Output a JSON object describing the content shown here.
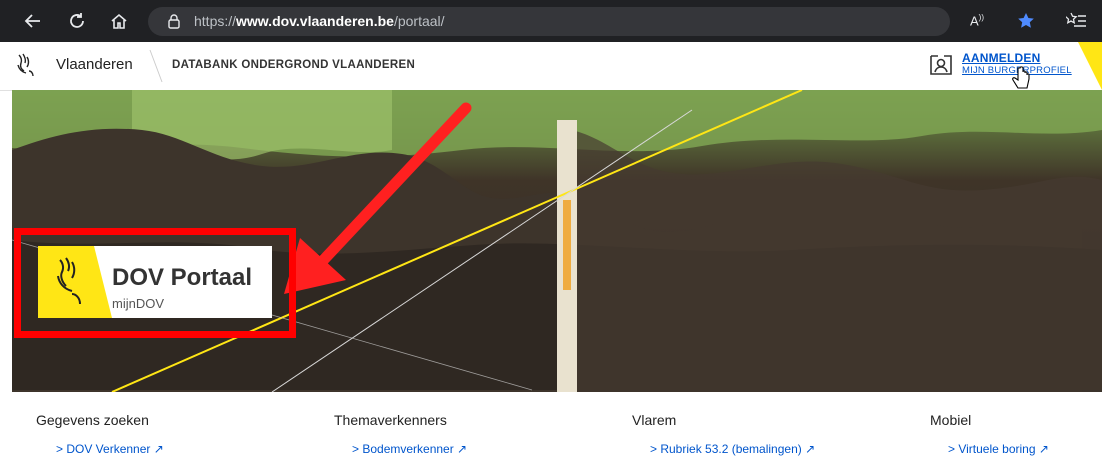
{
  "browser": {
    "url_prefix": "https://",
    "url_host": "www.dov.vlaanderen.be",
    "url_path": "/portaal/"
  },
  "header": {
    "brand": "Vlaanderen",
    "databank": "DATABANK ONDERGROND VLAANDEREN",
    "login_label": "AANMELDEN",
    "profile_label": "MIJN BURGERPROFIEL"
  },
  "hero": {
    "portal_title": "DOV Portaal",
    "portal_subtitle": "mijnDOV"
  },
  "footer": {
    "columns": [
      {
        "title": "Gegevens zoeken",
        "link": "> DOV Verkenner ↗"
      },
      {
        "title": "Themaverkenners",
        "link": "> Bodemverkenner ↗"
      },
      {
        "title": "Vlarem",
        "link": "> Rubriek 53.2 (bemalingen) ↗"
      },
      {
        "title": "Mobiel",
        "link": "> Virtuele boring ↗"
      }
    ]
  },
  "colors": {
    "brand_yellow": "#ffe615",
    "highlight_red": "#ff0000",
    "link_blue": "#0055cc"
  },
  "icons": [
    "back-icon",
    "reload-icon",
    "home-icon",
    "lock-icon",
    "read-aloud-icon",
    "favorite-star-icon",
    "favorites-list-icon",
    "vlaanderen-lion-icon",
    "login-icon",
    "cursor-hand-icon"
  ]
}
